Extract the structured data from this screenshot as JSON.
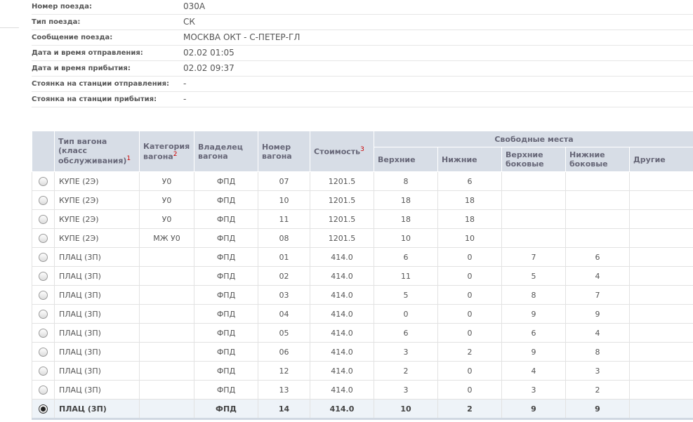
{
  "info": [
    {
      "label": "Номер поезда:",
      "value": "030А"
    },
    {
      "label": "Тип поезда:",
      "value": "СК"
    },
    {
      "label": "Сообщение поезда:",
      "value": "МОСКВА ОКТ - С-ПЕТЕР-ГЛ"
    },
    {
      "label": "Дата и время отправления:",
      "value": "02.02 01:05"
    },
    {
      "label": "Дата и время прибытия:",
      "value": "02.02 09:37"
    },
    {
      "label": "Стоянка на станции отправления:",
      "value": "-"
    },
    {
      "label": "Стоянка на станции прибытия:",
      "value": "-"
    }
  ],
  "table": {
    "headers": {
      "type": "Тип вагона (класс обслуживания)",
      "type_note": "1",
      "category": "Категория вагона",
      "category_note": "2",
      "owner": "Владелец вагона",
      "number": "Номер вагона",
      "price": "Стоимость",
      "price_note": "3",
      "free_seats": "Свободные места",
      "upper": "Верхние",
      "lower": "Нижние",
      "upper_side": "Верхние боковые",
      "lower_side": "Нижние боковые",
      "other": "Другие"
    },
    "rows": [
      {
        "type": "КУПЕ (2Э)",
        "category": "У0",
        "owner": "ФПД",
        "number": "07",
        "price": "1201.5",
        "upper": "8",
        "lower": "6",
        "upper_side": "",
        "lower_side": "",
        "other": "",
        "selected": false
      },
      {
        "type": "КУПЕ (2Э)",
        "category": "У0",
        "owner": "ФПД",
        "number": "10",
        "price": "1201.5",
        "upper": "18",
        "lower": "18",
        "upper_side": "",
        "lower_side": "",
        "other": "",
        "selected": false
      },
      {
        "type": "КУПЕ (2Э)",
        "category": "У0",
        "owner": "ФПД",
        "number": "11",
        "price": "1201.5",
        "upper": "18",
        "lower": "18",
        "upper_side": "",
        "lower_side": "",
        "other": "",
        "selected": false
      },
      {
        "type": "КУПЕ (2Э)",
        "category": "МЖ У0",
        "owner": "ФПД",
        "number": "08",
        "price": "1201.5",
        "upper": "10",
        "lower": "10",
        "upper_side": "",
        "lower_side": "",
        "other": "",
        "selected": false
      },
      {
        "type": "ПЛАЦ (3П)",
        "category": "",
        "owner": "ФПД",
        "number": "01",
        "price": "414.0",
        "upper": "6",
        "lower": "0",
        "upper_side": "7",
        "lower_side": "6",
        "other": "",
        "selected": false
      },
      {
        "type": "ПЛАЦ (3П)",
        "category": "",
        "owner": "ФПД",
        "number": "02",
        "price": "414.0",
        "upper": "11",
        "lower": "0",
        "upper_side": "5",
        "lower_side": "4",
        "other": "",
        "selected": false
      },
      {
        "type": "ПЛАЦ (3П)",
        "category": "",
        "owner": "ФПД",
        "number": "03",
        "price": "414.0",
        "upper": "5",
        "lower": "0",
        "upper_side": "8",
        "lower_side": "7",
        "other": "",
        "selected": false
      },
      {
        "type": "ПЛАЦ (3П)",
        "category": "",
        "owner": "ФПД",
        "number": "04",
        "price": "414.0",
        "upper": "0",
        "lower": "0",
        "upper_side": "9",
        "lower_side": "9",
        "other": "",
        "selected": false
      },
      {
        "type": "ПЛАЦ (3П)",
        "category": "",
        "owner": "ФПД",
        "number": "05",
        "price": "414.0",
        "upper": "6",
        "lower": "0",
        "upper_side": "6",
        "lower_side": "4",
        "other": "",
        "selected": false
      },
      {
        "type": "ПЛАЦ (3П)",
        "category": "",
        "owner": "ФПД",
        "number": "06",
        "price": "414.0",
        "upper": "3",
        "lower": "2",
        "upper_side": "9",
        "lower_side": "8",
        "other": "",
        "selected": false
      },
      {
        "type": "ПЛАЦ (3П)",
        "category": "",
        "owner": "ФПД",
        "number": "12",
        "price": "414.0",
        "upper": "2",
        "lower": "0",
        "upper_side": "4",
        "lower_side": "3",
        "other": "",
        "selected": false
      },
      {
        "type": "ПЛАЦ (3П)",
        "category": "",
        "owner": "ФПД",
        "number": "13",
        "price": "414.0",
        "upper": "3",
        "lower": "0",
        "upper_side": "3",
        "lower_side": "2",
        "other": "",
        "selected": false
      },
      {
        "type": "ПЛАЦ (3П)",
        "category": "",
        "owner": "ФПД",
        "number": "14",
        "price": "414.0",
        "upper": "10",
        "lower": "2",
        "upper_side": "9",
        "lower_side": "9",
        "other": "",
        "selected": true
      }
    ]
  }
}
